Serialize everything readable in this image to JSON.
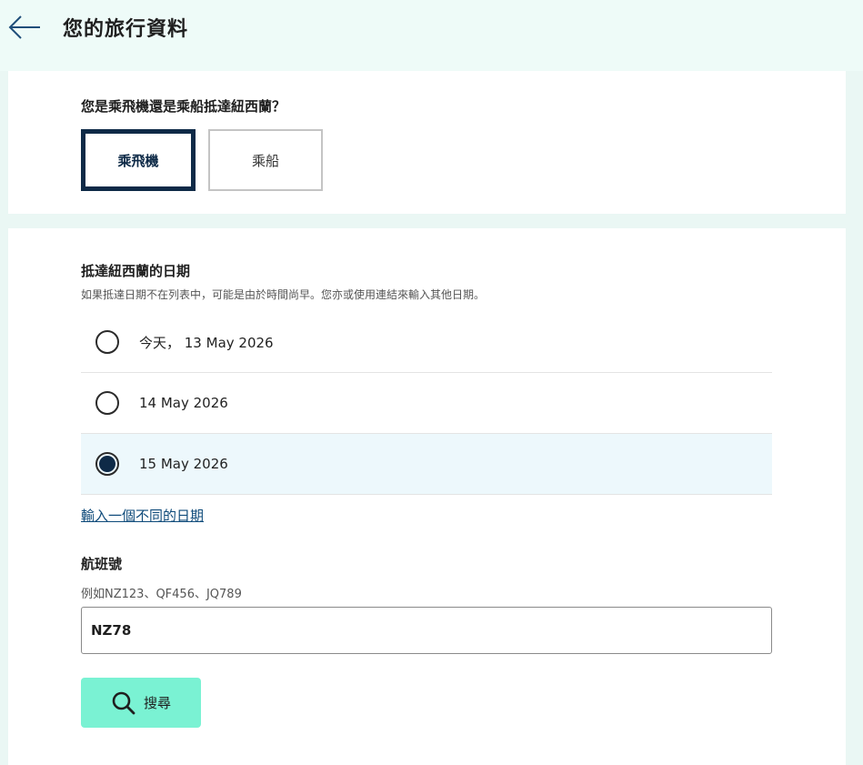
{
  "header": {
    "title": "您的旅行資料"
  },
  "arrival_mode": {
    "question": "您是乘飛機還是乘船抵達紐西蘭？",
    "options": [
      {
        "label": "乘飛機",
        "selected": true
      },
      {
        "label": "乘船",
        "selected": false
      }
    ]
  },
  "arrival_date": {
    "label": "抵達紐西蘭的日期",
    "hint": "如果抵達日期不在列表中，可能是由於時間尚早。您亦或使用連結來輸入其他日期。",
    "options": [
      {
        "label": "今天， 13 May 2026",
        "selected": false
      },
      {
        "label": "14 May 2026",
        "selected": false
      },
      {
        "label": "15 May 2026",
        "selected": true
      }
    ],
    "different_date_link": "輸入一個不同的日期"
  },
  "flight": {
    "label": "航班號",
    "hint": "例如NZ123、QF456、JQ789",
    "value": "NZ78",
    "search_label": "搜尋"
  },
  "colors": {
    "navy": "#0e2a47",
    "accent_button": "#7af2d3",
    "header_bg": "#eefbf8",
    "selected_row_bg": "#edf8fc"
  }
}
